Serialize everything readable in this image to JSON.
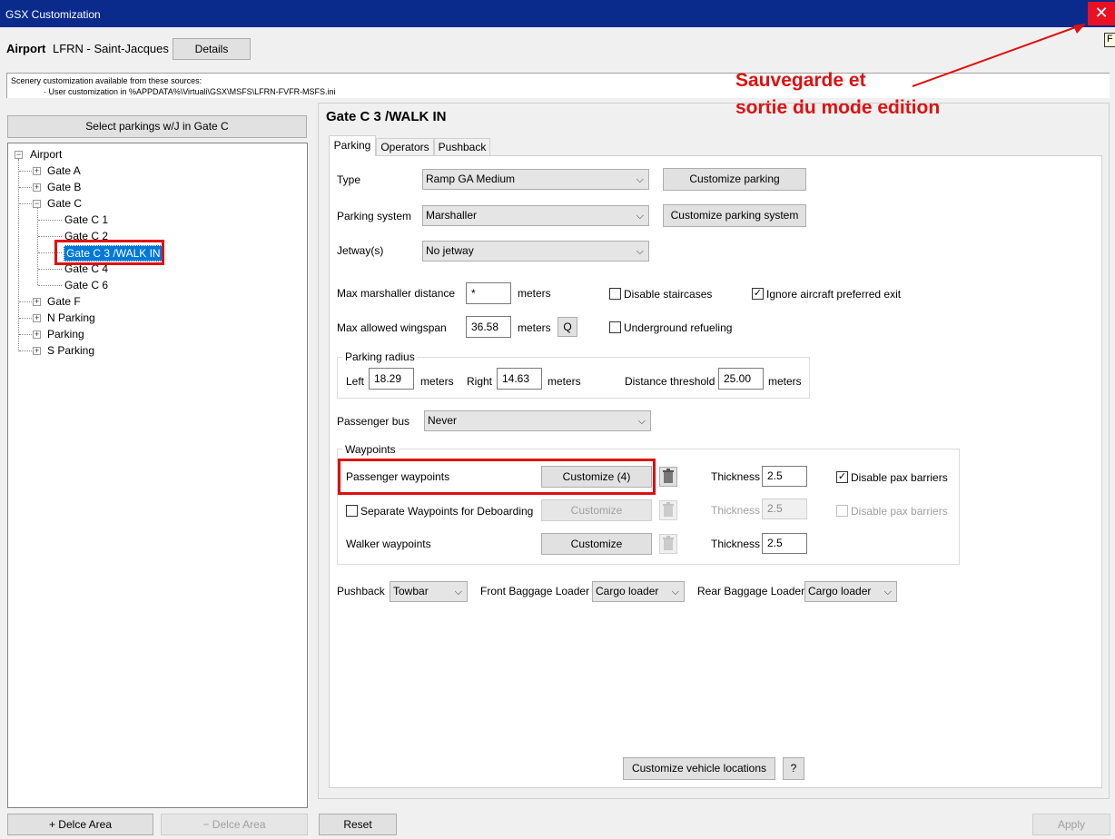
{
  "window": {
    "title": "GSX Customization",
    "close_glyph": "✕"
  },
  "header": {
    "airport_label": "Airport",
    "airport_value": "LFRN - Saint-Jacques",
    "details_button": "Details",
    "info_line1": "Scenery customization available from these sources:",
    "info_line2": "· User customization in %APPDATA%\\Virtuali\\GSX\\MSFS\\LFRN-FVFR-MSFS.ini",
    "corner_glyph": "F"
  },
  "annotation": {
    "line1": "Sauvegarde et",
    "line2": "sortie du mode edition",
    "color": "#e01010"
  },
  "left_panel": {
    "select_button": "Select parkings w/J in Gate C",
    "tree": {
      "root": "Airport",
      "items": [
        {
          "label": "Gate A"
        },
        {
          "label": "Gate B"
        },
        {
          "label": "Gate C",
          "children": [
            "Gate C 1",
            "Gate C 2",
            "Gate C 3 /WALK IN",
            "Gate C 4",
            "Gate C 6"
          ]
        },
        {
          "label": "Gate F"
        },
        {
          "label": "N Parking"
        },
        {
          "label": "Parking"
        },
        {
          "label": "S Parking"
        }
      ]
    },
    "add_button": "+ Delce Area",
    "remove_button": "− Delce Area"
  },
  "main": {
    "title": "Gate C 3 /WALK IN",
    "tabs": [
      "Parking",
      "Operators",
      "Pushback"
    ],
    "type_label": "Type",
    "type_value": "Ramp GA Medium",
    "customize_parking": "Customize parking",
    "system_label": "Parking system",
    "system_value": "Marshaller",
    "customize_system": "Customize parking system",
    "jetway_label": "Jetway(s)",
    "jetway_value": "No jetway",
    "max_marsh_label": "Max marshaller distance",
    "max_marsh_value": "*",
    "meters": "meters",
    "disable_staircases": "Disable staircases",
    "ignore_exit": "Ignore aircraft preferred exit",
    "max_wingspan_label": "Max allowed wingspan",
    "max_wingspan_value": "36.58",
    "q_button": "Q",
    "underground_refueling": "Underground refueling",
    "radius_group": "Parking radius",
    "left_label": "Left",
    "left_value": "18.29",
    "right_label": "Right",
    "right_value": "14.63",
    "distance_label": "Distance threshold",
    "distance_value": "25.00",
    "bus_label": "Passenger bus",
    "bus_value": "Never",
    "waypoints_group": "Waypoints",
    "pax_wp_label": "Passenger waypoints",
    "pax_wp_button": "Customize (4)",
    "thickness_label": "Thickness",
    "thickness1": "2.5",
    "disable_pax_barriers": "Disable pax barriers",
    "separate_wp_label": "Separate Waypoints for Deboarding",
    "customize_label": "Customize",
    "thickness2": "2.5",
    "walker_wp_label": "Walker waypoints",
    "thickness3": "2.5",
    "pushback_label": "Pushback",
    "pushback_value": "Towbar",
    "front_loader_label": "Front Baggage Loader",
    "front_loader_value": "Cargo loader",
    "rear_loader_label": "Rear Baggage Loader",
    "rear_loader_value": "Cargo loader",
    "vehicle_locations": "Customize vehicle locations",
    "help_button": "?"
  },
  "footer": {
    "reset": "Reset",
    "apply": "Apply"
  },
  "icons": {
    "combo_arrow": "chevron-down-icon",
    "trash": "trash-icon",
    "check": "✓",
    "arrow_down": "⌵"
  }
}
